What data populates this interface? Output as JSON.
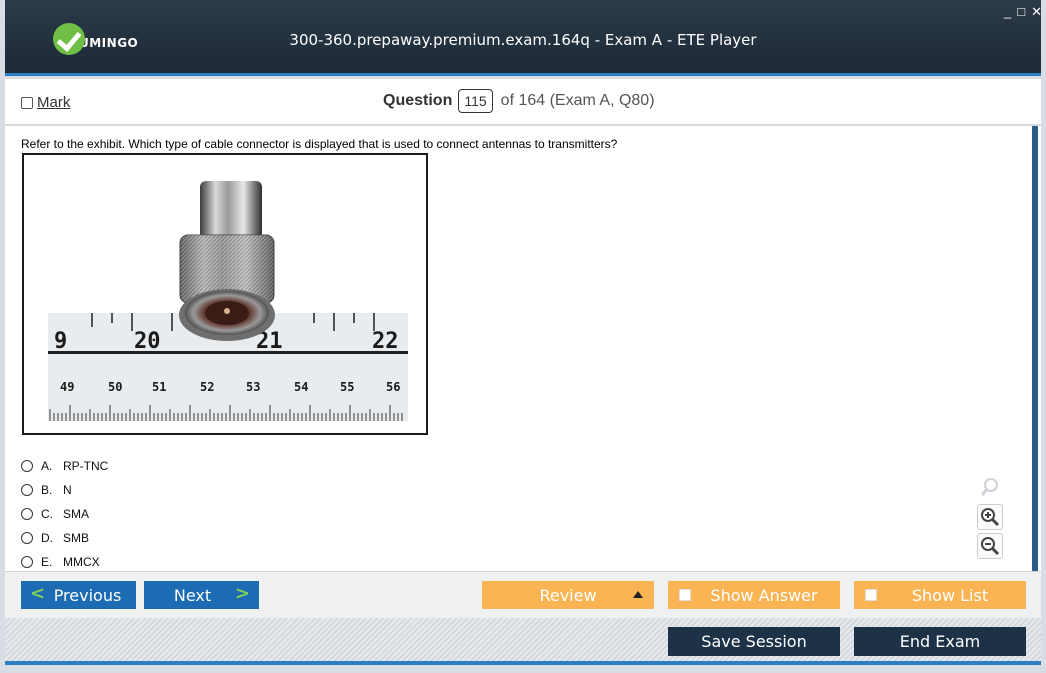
{
  "app": {
    "logo_text": "UMINGO",
    "window_title": "300-360.prepaway.premium.exam.164q - Exam A - ETE Player",
    "window_controls": {
      "minimize": "_",
      "maximize": "□",
      "close": "✕"
    }
  },
  "header": {
    "mark_label": "Mark",
    "question_word": "Question",
    "question_number": "115",
    "question_of": "of 164 (Exam A, Q80)"
  },
  "question": {
    "text": "Refer to the exhibit. Which type of cable connector is displayed that is used to connect antennas to transmitters?",
    "ruler_top_numbers": [
      "9",
      "20",
      "21",
      "22"
    ],
    "ruler_bottom_numbers": [
      "49",
      "50",
      "51",
      "52",
      "53",
      "54",
      "55",
      "56"
    ],
    "options": [
      {
        "letter": "A.",
        "text": "RP-TNC"
      },
      {
        "letter": "B.",
        "text": "N"
      },
      {
        "letter": "C.",
        "text": "SMA"
      },
      {
        "letter": "D.",
        "text": "SMB"
      },
      {
        "letter": "E.",
        "text": "MMCX"
      }
    ]
  },
  "nav": {
    "previous_label": "Previous",
    "next_label": "Next",
    "review_label": "Review",
    "show_answer_label": "Show Answer",
    "show_list_label": "Show List"
  },
  "footer": {
    "save_label": "Save Session",
    "end_label": "End Exam"
  },
  "colors": {
    "titlebar": "#1d2935",
    "accent_blue": "#1c6bb3",
    "orange": "#fbb454",
    "dark_button": "#1d3247",
    "logo_green": "#6fbe45"
  }
}
